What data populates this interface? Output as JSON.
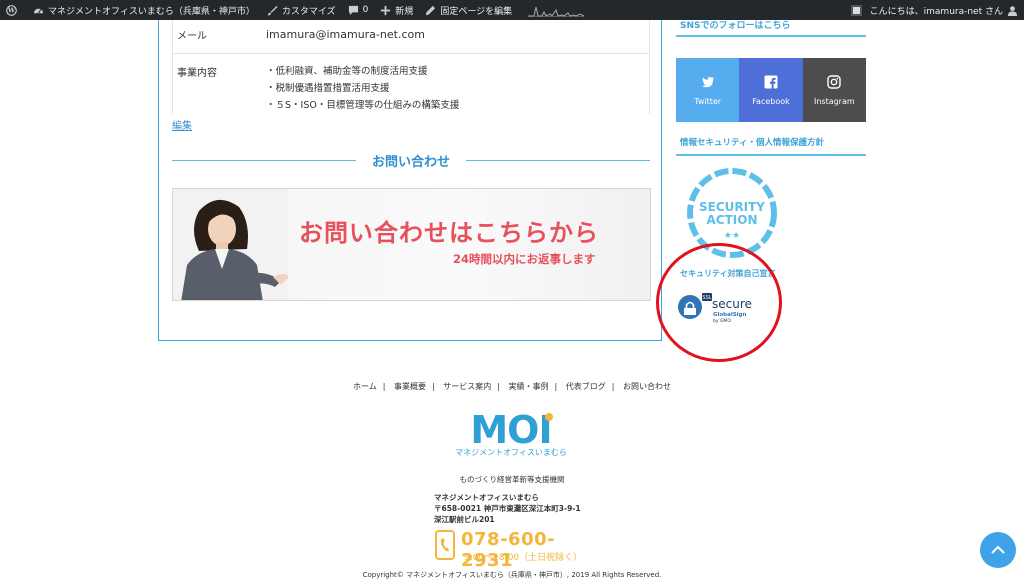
{
  "adminbar": {
    "site_name": "マネジメントオフィスいまむら（兵庫県・神戸市）",
    "customize": "カスタマイズ",
    "comments_count": "0",
    "new": "新規",
    "edit_page": "固定ページを編集",
    "greeting": "こんにちは、imamura-net さん"
  },
  "company_table": {
    "email_label": "メール",
    "email_value": "imamura@imamura-net.com",
    "business_label": "事業内容",
    "business_items": [
      "・低利融資、補助金等の制度活用支援",
      "・税制優遇措置措置活用支援",
      "・５S・ISO・目標管理等の仕組みの構築支援"
    ]
  },
  "edit_link": "編集",
  "contact": {
    "heading": "お問い合わせ",
    "banner_main": "お問い合わせはこちらから",
    "banner_sub": "24時間以内にお返事します"
  },
  "sidebar": {
    "sns_title": "SNSでのフォローはこちら",
    "sns_buttons": [
      "Twitter",
      "Facebook",
      "Instagram"
    ],
    "security_title": "情報セキュリティ・個人情報保護方針",
    "badge_text": [
      "SECURITY",
      "ACTION"
    ],
    "badge_stars": "★★",
    "badge_caption": "セキュリティ対策自己宣言",
    "ssl_badge": {
      "tag": "SSL",
      "word": "secure",
      "brand": "GlobalSign",
      "by": "by GMO"
    }
  },
  "footer": {
    "nav": [
      "ホーム",
      "事業概要",
      "サービス案内",
      "実績・事例",
      "代表ブログ",
      "お問い合わせ"
    ],
    "logo_text": "MOI",
    "logo_sub": "マネジメントオフィスいまむら",
    "tagline": "ものづくり経営革新等支援機関",
    "address_lines": [
      "マネジメントオフィスいまむら",
      "〒658-0021 神戸市東灘区深江本町3-9-1",
      "深江駅前ビル201"
    ],
    "tel": "078-600-2931",
    "hours": "9:00～18:00（土日祝除く）",
    "copyright": "Copyright© マネジメントオフィスいまむら（兵庫県・神戸市）, 2019 All Rights Reserved."
  },
  "colors": {
    "accent": "#3ea3d8",
    "banner_text": "#e8505b",
    "tel": "#f4b53c",
    "highlight_circle": "#e0121b"
  }
}
